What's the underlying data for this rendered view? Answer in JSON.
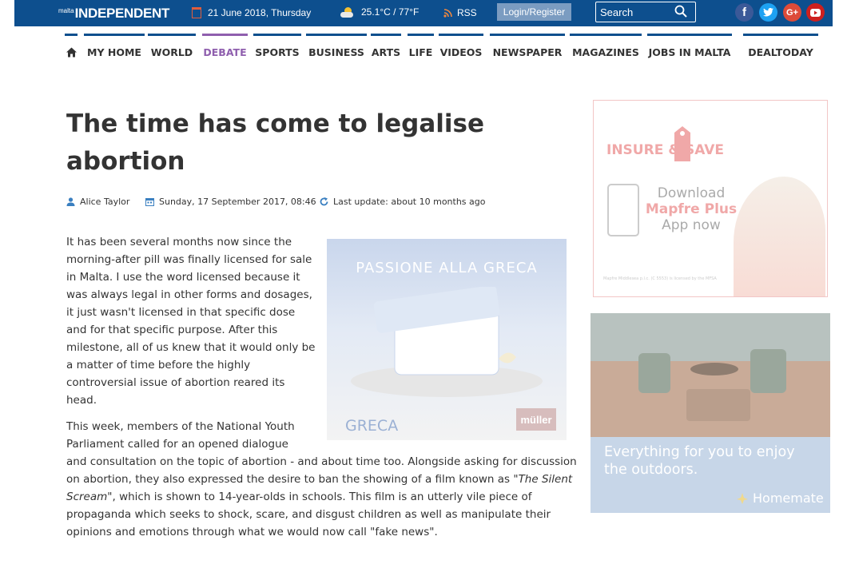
{
  "topbar": {
    "logo_prefix": "malta",
    "logo_name": "INDEPENDENT",
    "date": "21 June 2018, Thursday",
    "weather": "25.1°C / 77°F",
    "rss": "RSS",
    "login_label": "Login/Register",
    "search_placeholder": "Search",
    "social": [
      "facebook-icon",
      "twitter-icon",
      "google-plus-icon",
      "youtube-icon"
    ]
  },
  "nav": {
    "items": [
      {
        "label": "MY HOME"
      },
      {
        "label": "WORLD"
      },
      {
        "label": "DEBATE",
        "active": true
      },
      {
        "label": "SPORTS"
      },
      {
        "label": "BUSINESS"
      },
      {
        "label": "ARTS"
      },
      {
        "label": "LIFE"
      },
      {
        "label": "VIDEOS"
      },
      {
        "label": "NEWSPAPER"
      },
      {
        "label": "MAGAZINES"
      },
      {
        "label": "JOBS IN MALTA"
      },
      {
        "label": "DEALTODAY"
      }
    ]
  },
  "article": {
    "title": "The time has come to legalise abortion",
    "author": "Alice Taylor",
    "published": "Sunday, 17 September 2017, 08:46",
    "last_update": "Last update: about 10 months ago",
    "paragraph_1": "It has been several months now since the morning-after pill was finally licensed for sale in Malta. I use the word licensed because it was always legal in other forms and dosages, it just wasn't licensed in that specific dose and for that specific purpose. After this milestone, all of us knew that it would only be a matter of time before the highly controversial issue of abortion reared its head.",
    "paragraph_2_start": "This week, members of the National Youth Parliament called for an opened dialogue",
    "paragraph_2_rest_a": "and consultation on the topic of abortion - and about time too. Alongside asking for discussion on abortion, they also expressed the desire to ban the showing of a film known as \"",
    "paragraph_2_film": "The Silent Scream",
    "paragraph_2_rest_b": "\", which is shown to 14-year-olds in schools. This film is an utterly vile piece of propaganda which seeks to shock, scare, and disgust children as well as manipulate their opinions and emotions through what we would now call \"fake news\"."
  },
  "inline_ad": {
    "caption": "PASSIONE ALLA GRECA",
    "brand": "GRECA",
    "logo": "müller"
  },
  "ad_insurance": {
    "headline": "INSURE & SAVE",
    "line1": "Download",
    "line2": "Mapfre Plus",
    "line3": "App now",
    "fine_print": "Mapfre Middlesea p.l.c. (C 5553) is licensed by the MFSA"
  },
  "ad_outdoor": {
    "text": "Everything for you to enjoy the outdoors.",
    "brand": "Homemate"
  },
  "colors": {
    "topbar": "#0d4f8e",
    "nav_active": "#8f5fae",
    "login_button": "#7b9cc1"
  }
}
